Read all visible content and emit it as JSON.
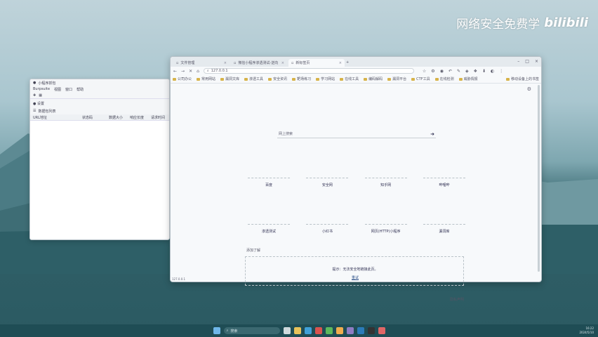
{
  "watermark": {
    "text": "网络安全免费学",
    "brand": "bilibili"
  },
  "left_window": {
    "title": "小程序抓包",
    "menu": [
      "Burpsuite",
      "视图",
      "窗口",
      "帮助"
    ],
    "tool_icon": "settings-icon",
    "tab_label": "设置",
    "section_label": "数据包列表",
    "columns": [
      "URL地址",
      "状态码",
      "数据大小",
      "响应长度",
      "请求时间"
    ]
  },
  "browser": {
    "tabs": [
      {
        "label": "文件管理"
      },
      {
        "label": "微信小程序渗透测试-逆向"
      },
      {
        "label": "新标签页"
      }
    ],
    "url": "127.0.0.1",
    "bookmarks": [
      "公司办公",
      "常用网站",
      "漏洞文库",
      "渗透工具",
      "安全资讯",
      "靶场练习",
      "学习网站",
      "在线工具",
      "编码解码",
      "漏洞平台",
      "CTF工具",
      "在线检测",
      "威胁情报"
    ],
    "bookmark_right": "移动设备上的书签",
    "search_placeholder": "网上搜索",
    "shortcuts_row1": [
      "百度",
      "安全网",
      "知乎网",
      "哔哩哔"
    ],
    "shortcuts_row2": [
      "渗透测试",
      "小红书",
      "网页(HTTP)小程序",
      "漏洞库"
    ],
    "more_label": "添加了解",
    "notice_text": "提示：无法安全地链接此页。",
    "notice_link": "重试",
    "footer_link": "隐私声明",
    "status": "127.0.0.1"
  },
  "taskbar": {
    "search_label": "搜索",
    "time": "16:22",
    "date": "2024/5/10"
  }
}
